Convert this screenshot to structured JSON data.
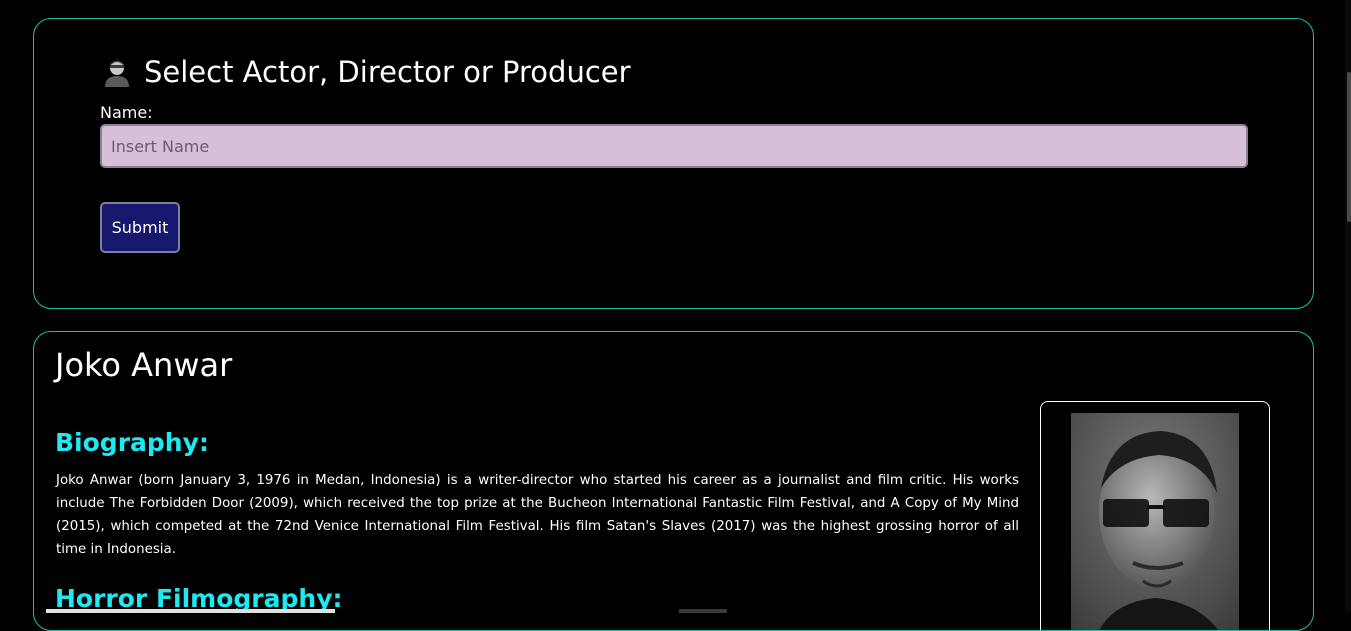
{
  "search": {
    "heading": "Select Actor, Director or Producer",
    "icon": "person-icon",
    "name_label": "Name:",
    "name_placeholder": "Insert Name",
    "name_value": "",
    "submit_label": "Submit"
  },
  "result": {
    "name": "Joko Anwar",
    "biography_heading": "Biography:",
    "biography_text": "Joko Anwar (born January 3, 1976 in Medan, Indonesia) is a writer-director who started his career as a journalist and film critic. His works include The Forbidden Door (2009), which received the top prize at the Bucheon International Fantastic Film Festival, and A Copy of My Mind (2015), which competed at the 72nd Venice International Film Festival. His film Satan's Slaves (2017) was the highest grossing horror of all time in Indonesia.",
    "filmography_heading": "Horror Filmography:"
  },
  "colors": {
    "card_border": "#1fbfa6",
    "heading_accent": "#1ee8f0",
    "input_background": "#d8bfd8",
    "button_background": "#17176e"
  }
}
